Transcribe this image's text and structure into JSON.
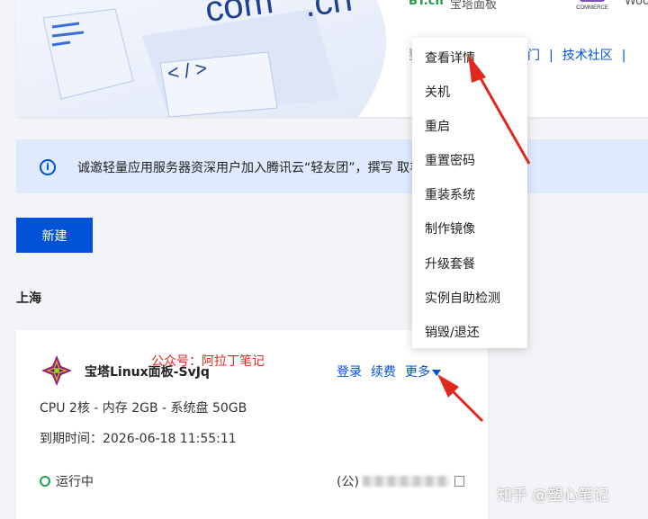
{
  "banner": {
    "brand_bt_mark": "BT.cn",
    "brand_bt_name": "宝塔面板",
    "brand_woo_mark": "COMMERCE",
    "brand_woo_name": "WooC",
    "links": [
      "门",
      "技术社区",
      ""
    ],
    "art_text_left": "com",
    "art_text_right": ".cn",
    "art_code": "< / >"
  },
  "notice": {
    "icon": "info-icon",
    "text": "诚邀轻量应用服务器资深用户加入腾讯云“轻友团”，撰写                                    取丰厚代金券奖励，"
  },
  "toolbar": {
    "new_label": "新建"
  },
  "region": "上海",
  "server": {
    "name": "宝塔Linux面板-SvJq",
    "watermark": "公众号：阿拉丁笔记",
    "actions": {
      "login": "登录",
      "renew": "续费",
      "more": "更多"
    },
    "specs": "CPU 2核 - 内存 2GB - 系统盘 50GB",
    "expire": "到期时间：2026-06-18 11:55:11",
    "status": "运行中",
    "ip_prefix": "(公)"
  },
  "menu": {
    "items": [
      "查看详情",
      "关机",
      "重启",
      "重置密码",
      "重装系统",
      "制作镜像",
      "升级套餐",
      "实例自助检测",
      "销毁/退还"
    ]
  },
  "watermark_footer": "知乎 @塑心笔记",
  "colors": {
    "primary": "#0052d9",
    "annotation": "#e0281e",
    "running": "#1ba354",
    "notice_bg": "#dfeafe"
  }
}
